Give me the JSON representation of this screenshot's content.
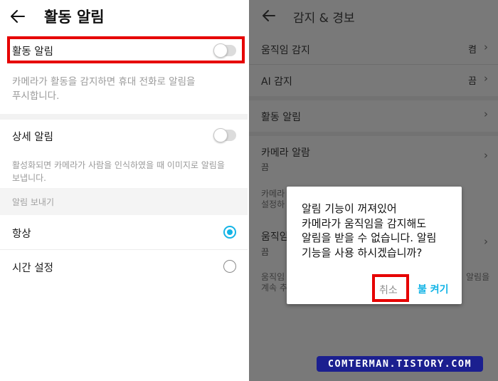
{
  "left": {
    "title": "활동 알림",
    "activity_toggle_label": "활동 알림",
    "activity_toggle_on": false,
    "activity_desc": "카메라가 활동을 감지하면 휴대 전화로 알림을\n푸시합니다.",
    "detail_toggle_label": "상세 알림",
    "detail_toggle_on": false,
    "detail_desc": "활성화되면 카메라가 사람을 인식하였을 때 이미지로 알림을\n보냅니다.",
    "section_title": "알림 보내기",
    "options": [
      {
        "label": "항상",
        "selected": true
      },
      {
        "label": "시간 설정",
        "selected": false
      }
    ]
  },
  "right": {
    "title": "감지 & 경보",
    "rows": [
      {
        "label": "움직임 감지",
        "value": "켬"
      },
      {
        "label": "AI 감지",
        "value": "끔"
      },
      {
        "label": "활동 알림",
        "value": ""
      },
      {
        "label": "카메라 알람",
        "value": "",
        "sub": "끔"
      }
    ],
    "partial_desc_1a": "카메라",
    "partial_desc_1b": "설정하",
    "partial_row_label": "움직임",
    "partial_row_sub": "끔",
    "partial_desc_2a_left": "움직임",
    "partial_desc_2a_right": "알림을",
    "partial_desc_2b_left": "계속 추",
    "dialog": {
      "message": "알림 기능이 꺼져있어\n카메라가 움직임을 감지해도\n알림을 받을 수 없습니다. 알림\n기능을 사용 하시겠습니까?",
      "cancel_label": "취소",
      "confirm_label": "불 켜기"
    }
  },
  "watermark": "COMTERMAN.TISTORY.COM",
  "colors": {
    "accent": "#14b4e6",
    "highlight": "#e60000",
    "overlay": "#797979",
    "watermark_bg": "#1b1f8f"
  },
  "icons": {
    "back": "back-arrow-icon",
    "chevron": "chevron-right-icon"
  }
}
